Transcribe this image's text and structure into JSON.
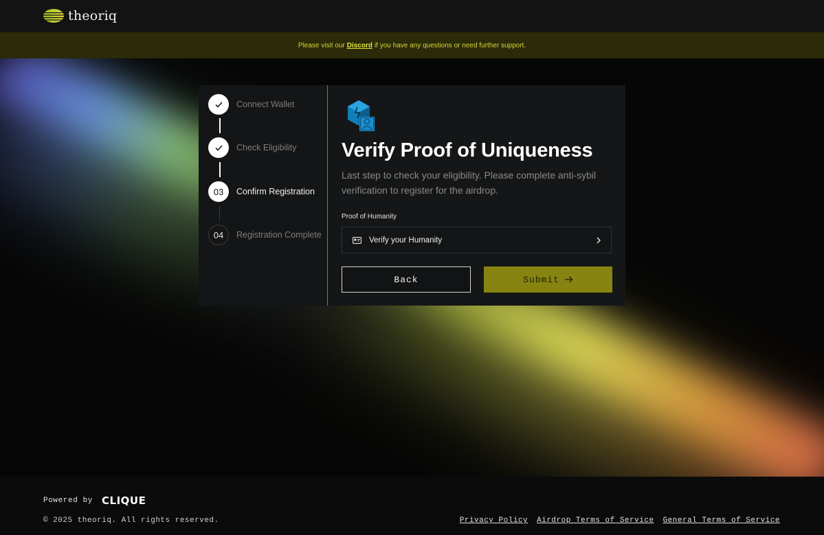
{
  "header": {
    "brand": "theoriq",
    "logo_icon": "theoriq-logo-icon"
  },
  "banner": {
    "prefix": "Please visit our",
    "link": "Discord",
    "suffix": "if you have any questions or need further support.",
    "color": "#d8d83a"
  },
  "steps": [
    {
      "number": "",
      "label": "Connect Wallet",
      "state": "done"
    },
    {
      "number": "",
      "label": "Check Eligibility",
      "state": "done"
    },
    {
      "number": "03",
      "label": "Confirm Registration",
      "state": "active"
    },
    {
      "number": "04",
      "label": "Registration Complete",
      "state": "pending"
    }
  ],
  "main": {
    "icon": "proof-of-uniqueness-icon",
    "title": "Verify Proof of Uniqueness",
    "description": "Last step to check your eligibility. Please complete anti-sybil verification to register for the airdrop.",
    "field_label": "Proof of Humanity",
    "verify_option": "Verify your Humanity",
    "back_label": "Back",
    "submit_label": "Submit"
  },
  "footer": {
    "powered_by": "Powered by",
    "partner": "CLIQUE",
    "copyright": "© 2025 theoriq. All rights reserved.",
    "links": [
      "Privacy Policy",
      "Airdrop Terms of Service",
      "General Terms of Service"
    ]
  },
  "colors": {
    "accent": "#878411",
    "step_border": "#6b8b22",
    "card_bg": "#151617",
    "banner_bg": "#2b2a09"
  }
}
